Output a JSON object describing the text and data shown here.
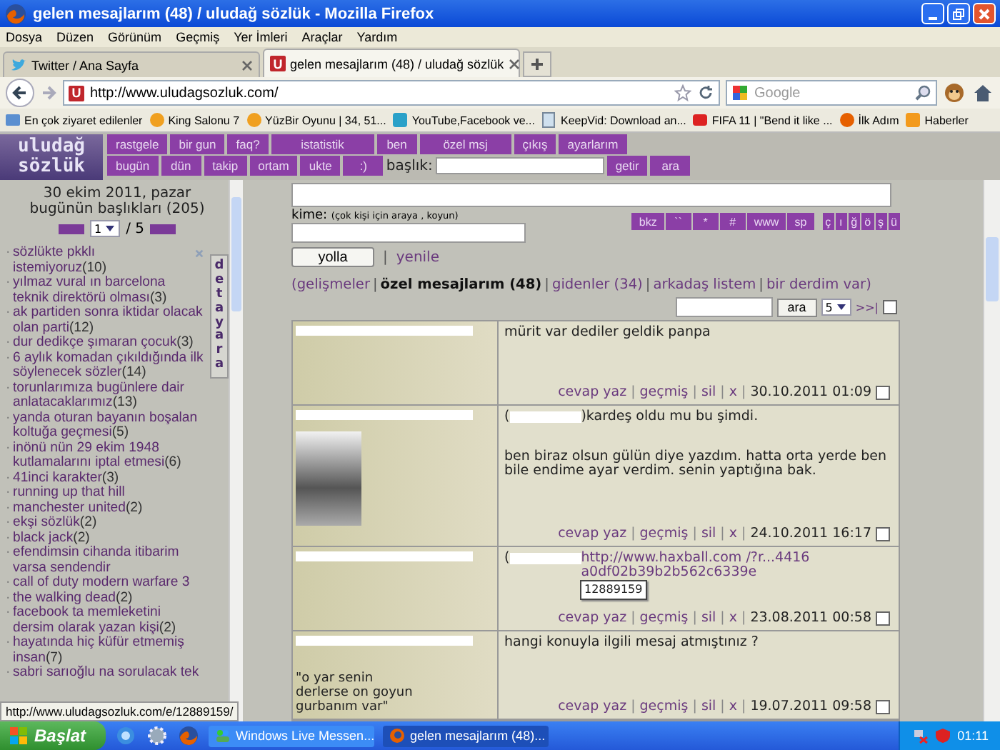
{
  "window": {
    "title": "gelen mesajlarım (48) / uludağ sözlük - Mozilla Firefox"
  },
  "menu": [
    "Dosya",
    "Düzen",
    "Görünüm",
    "Geçmiş",
    "Yer İmleri",
    "Araçlar",
    "Yardım"
  ],
  "tabs": [
    {
      "label": "Twitter / Ana Sayfa",
      "kind": "twitter",
      "selected": false
    },
    {
      "label": "gelen mesajlarım (48) / uludağ sözlük",
      "kind": "site",
      "favicon": "U",
      "selected": true
    }
  ],
  "address": {
    "favicon": "U",
    "url": "http://www.uludagsozluk.com/"
  },
  "search": {
    "placeholder": "Google"
  },
  "bookmarks": [
    {
      "label": "En çok ziyaret edilenler",
      "kind": "folder"
    },
    {
      "label": "King Salonu 7",
      "kind": "game"
    },
    {
      "label": "YüzBir Oyunu | 34, 51...",
      "kind": "game"
    },
    {
      "label": "YouTube,Facebook ve...",
      "kind": "video"
    },
    {
      "label": "KeepVid: Download an...",
      "kind": "page"
    },
    {
      "label": "FIFA 11 | \"Bend it like ...",
      "kind": "tube"
    },
    {
      "label": "İlk Adım",
      "kind": "firefox"
    },
    {
      "label": "Haberler",
      "kind": "feed"
    }
  ],
  "site": {
    "logo": [
      "uludağ",
      "sözlük"
    ],
    "nav_top": [
      "rastgele",
      "bir gun",
      "faq?",
      "istatistik",
      "ben",
      "özel msj",
      "çıkış",
      "ayarlarım"
    ],
    "nav_bottom": [
      "bugün",
      "dün",
      "takip",
      "ortam",
      "ukte",
      ":)"
    ],
    "title_label": "başlık:",
    "title_buttons": [
      "getir",
      "ara"
    ]
  },
  "sidebar": {
    "date": "30 ekim 2011, pazar",
    "today": "bugünün başlıkları (205)",
    "page": "1",
    "total": "/ 5",
    "bullet": "·",
    "detail_tab": "detay ara",
    "items": [
      {
        "title": "sözlükte pkklı istemiyoruz",
        "count": "(10)",
        "removable": true
      },
      {
        "title": "yılmaz vural ın barcelona teknik direktörü olması",
        "count": "(3)",
        "removable": false
      },
      {
        "title": "ak partiden sonra iktidar olacak olan parti",
        "count": "(12)",
        "removable": false
      },
      {
        "title": "dur dedikçe şımaran çocuk",
        "count": "(3)",
        "removable": false
      },
      {
        "title": "6 aylık komadan çıkıldığında ilk söylenecek sözler",
        "count": "(14)",
        "removable": false
      },
      {
        "title": "torunlarımıza bugünlere dair anlatacaklarımız",
        "count": "(13)",
        "removable": false
      },
      {
        "title": "yanda oturan bayanın boşalan koltuğa geçmesi",
        "count": "(5)",
        "removable": false
      },
      {
        "title": "inönü nün 29 ekim 1948 kutlamalarını iptal etmesi",
        "count": "(6)",
        "removable": false
      },
      {
        "title": "41inci karakter",
        "count": "(3)",
        "removable": false
      },
      {
        "title": "running up that hill",
        "removable": false
      },
      {
        "title": "manchester united",
        "count": "(2)",
        "removable": false
      },
      {
        "title": "ekşi sözlük",
        "count": "(2)",
        "removable": false
      },
      {
        "title": "black jack",
        "count": "(2)",
        "removable": false
      },
      {
        "title": "efendimsin cihanda itibarim varsa sendendir",
        "removable": false
      },
      {
        "title": "call of duty modern warfare 3",
        "removable": false
      },
      {
        "title": "the walking dead",
        "count": "(2)",
        "removable": false
      },
      {
        "title": "facebook ta memleketini dersim olarak yazan kişi",
        "count": "(2)",
        "removable": false
      },
      {
        "title": "hayatında hiç küfür etmemiş insan",
        "count": "(7)",
        "removable": false
      },
      {
        "title": "sabri sarıoğlu na sorulacak tek",
        "removable": false
      }
    ]
  },
  "compose": {
    "to_label": "kime:",
    "to_hint": "(çok kişi için araya , koyun)",
    "format_buttons": [
      "bkz",
      "``",
      "*",
      "#",
      "www",
      "sp"
    ],
    "char_buttons": [
      "ç",
      "ı",
      "ğ",
      "ö",
      "ş",
      "ü"
    ],
    "send": "yolla",
    "separator": "|",
    "refresh": "yenile"
  },
  "message_nav": {
    "open": "(",
    "close": ")",
    "separator": "|",
    "links": [
      {
        "label": "gelişmeler",
        "selected": false
      },
      {
        "label": "özel mesajlarım (48)",
        "selected": true
      },
      {
        "label": "gidenler (34)",
        "selected": false
      },
      {
        "label": "arkadaş listem",
        "selected": false
      },
      {
        "label": "bir derdim var",
        "selected": false
      }
    ]
  },
  "filter": {
    "search_button": "ara",
    "per_page": "5",
    "last": ">>|",
    "checked": false
  },
  "messages": [
    {
      "avatar": false,
      "body": [
        {
          "kind": "text",
          "text": "mürit var dediler geldik panpa"
        }
      ],
      "actions": [
        "cevap yaz",
        "geçmiş",
        "sil",
        "x"
      ],
      "separator": "|",
      "date": "30.10.2011 01:09",
      "checked": false
    },
    {
      "avatar": true,
      "body": [
        {
          "kind": "quote",
          "before": "(",
          "after": ")kardeş oldu mu bu şimdi."
        },
        {
          "kind": "text",
          "text": "ben biraz olsun gülün diye yazdım. hatta orta yerde ben bile endime ayar verdim. senin yaptığına bak."
        }
      ],
      "actions": [
        "cevap yaz",
        "geçmiş",
        "sil",
        "x"
      ],
      "separator": "|",
      "date": "24.10.2011 16:17",
      "checked": false
    },
    {
      "avatar": false,
      "body": [
        {
          "kind": "link",
          "before": "(",
          "link": "http://www.haxball.com /?r...4416a0df02b39b2b562c6339e"
        }
      ],
      "tooltip": "12889159",
      "actions": [
        "cevap yaz",
        "geçmiş",
        "sil",
        "x"
      ],
      "separator": "|",
      "date": "23.08.2011 00:58",
      "checked": false
    },
    {
      "avatar": false,
      "signature": "\"o yar senin derlerse on goyun gurbanım var\"",
      "body": [
        {
          "kind": "text",
          "text": "hangi konuyla ilgili mesaj atmıştınız ?"
        }
      ],
      "actions": [
        "cevap yaz",
        "geçmiş",
        "sil",
        "x"
      ],
      "separator": "|",
      "date": "19.07.2011 09:58",
      "checked": false
    }
  ],
  "status_bar": {
    "url": "http://www.uludagsozluk.com/e/12889159/"
  },
  "taskbar": {
    "start": "Başlat",
    "tasks": [
      {
        "label": "Windows Live Messen...",
        "kind": "messenger",
        "selected": false
      },
      {
        "label": "gelen mesajlarım (48)...",
        "kind": "firefox",
        "selected": true
      }
    ],
    "clock": "01:11"
  }
}
